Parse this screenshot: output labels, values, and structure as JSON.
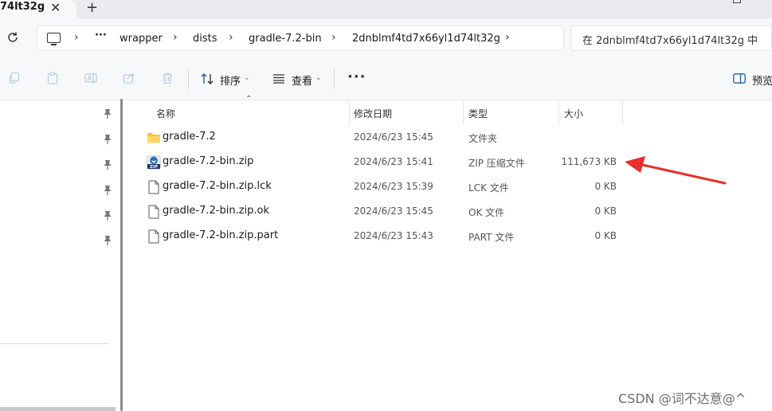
{
  "tab": {
    "title": "74lt32g",
    "close": "✕",
    "new_tab": "+"
  },
  "address": {
    "overflow": "···",
    "crumbs": [
      "wrapper",
      "dists",
      "gradle-7.2-bin",
      "2dnblmf4td7x66yl1d74lt32g"
    ],
    "search_placeholder": "在 2dnblmf4td7x66yl1d74lt32g 中"
  },
  "toolbar": {
    "sort_label": "排序",
    "view_label": "查看",
    "more": "···",
    "preview_label": "预览"
  },
  "columns": {
    "name": "名称",
    "date": "修改日期",
    "type": "类型",
    "size": "大小"
  },
  "files": [
    {
      "name": "gradle-7.2",
      "date": "2024/6/23 15:45",
      "type": "文件夹",
      "size": "",
      "icon": "folder-icon"
    },
    {
      "name": "gradle-7.2-bin.zip",
      "date": "2024/6/23 15:41",
      "type": "ZIP 压缩文件",
      "size": "111,673 KB",
      "icon": "zip-file-icon"
    },
    {
      "name": "gradle-7.2-bin.zip.lck",
      "date": "2024/6/23 15:39",
      "type": "LCK 文件",
      "size": "0 KB",
      "icon": "file-icon"
    },
    {
      "name": "gradle-7.2-bin.zip.ok",
      "date": "2024/6/23 15:45",
      "type": "OK 文件",
      "size": "0 KB",
      "icon": "file-icon"
    },
    {
      "name": "gradle-7.2-bin.zip.part",
      "date": "2024/6/23 15:43",
      "type": "PART 文件",
      "size": "0 KB",
      "icon": "file-icon"
    }
  ],
  "watermark": "CSDN @词不达意@^",
  "colors": {
    "annotation_arrow": "#e8302c",
    "folder": "#f5c445",
    "zip_icon": "#2a6fb8"
  }
}
